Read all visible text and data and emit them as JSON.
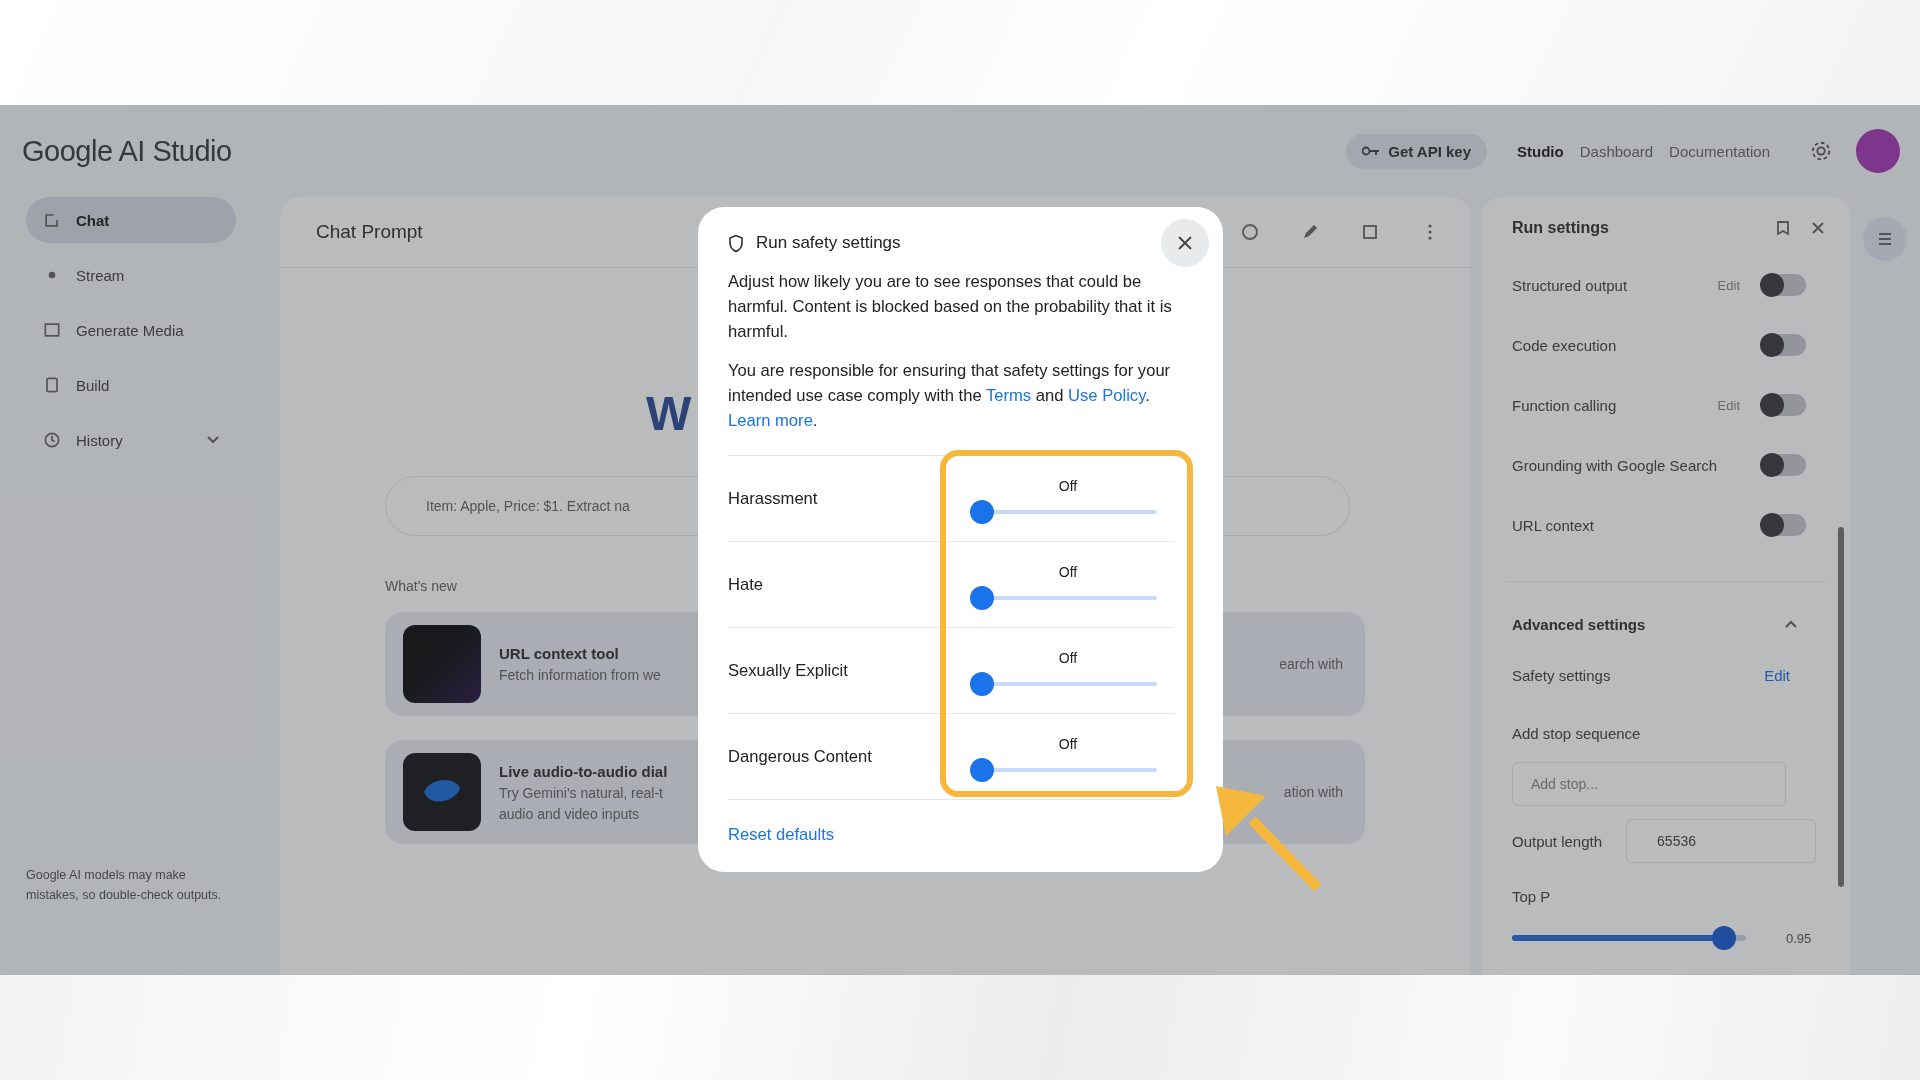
{
  "header": {
    "logo": "Google AI Studio",
    "api_key_button": "Get API key",
    "nav": [
      {
        "label": "Studio",
        "selected": true
      },
      {
        "label": "Dashboard",
        "selected": false
      },
      {
        "label": "Documentation",
        "selected": false
      }
    ]
  },
  "sidebar": {
    "items": [
      {
        "label": "Chat",
        "selected": true
      },
      {
        "label": "Stream",
        "selected": false
      },
      {
        "label": "Generate Media",
        "selected": false
      },
      {
        "label": "Build",
        "selected": false
      },
      {
        "label": "History",
        "selected": false
      }
    ],
    "disclaimer": "Google AI models may make mistakes, so double-check outputs."
  },
  "main": {
    "title": "Chat Prompt",
    "heading": "W",
    "prompt_suggestion": "Item: Apple, Price: $1. Extract na",
    "whats_new": {
      "title": "What's new",
      "cards": [
        {
          "title": "URL context tool",
          "lines": [
            "Fetch information from we"
          ],
          "trailing": "earch with"
        },
        {
          "title": "Live audio-to-audio dial",
          "lines": [
            "Try Gemini's natural, real-t",
            "audio and video inputs"
          ],
          "trailing": "ation with"
        }
      ]
    }
  },
  "run_settings": {
    "title": "Run settings",
    "tools": [
      {
        "label": "Structured output",
        "action": "Edit",
        "on": false
      },
      {
        "label": "Code execution",
        "on": false
      },
      {
        "label": "Function calling",
        "action": "Edit",
        "on": false
      },
      {
        "label": "Grounding with Google Search",
        "on": false
      },
      {
        "label": "URL context",
        "on": false
      }
    ],
    "advanced": {
      "title": "Advanced settings",
      "expanded": true,
      "safety": {
        "label": "Safety settings",
        "action": "Edit"
      },
      "stop_sequence": {
        "label": "Add stop sequence",
        "placeholder": "Add stop..."
      },
      "output_length": {
        "label": "Output length",
        "value": "65536"
      },
      "top_p": {
        "label": "Top P",
        "level": 0.95,
        "reading": "0.95"
      }
    }
  },
  "dialog": {
    "title": "Run safety settings",
    "intro": "Adjust how likely you are to see responses that could be harmful. Content is blocked based on the probability that it is harmful.",
    "notice": [
      {
        "text": "You are responsible for ensuring that safety settings for your intended use case comply with the ",
        "link": false
      },
      {
        "text": "Terms",
        "link": true
      },
      {
        "text": " and ",
        "link": false
      },
      {
        "text": "Use Policy",
        "link": true
      },
      {
        "text": ". ",
        "link": false
      },
      {
        "text": "Learn more",
        "link": true
      },
      {
        "text": ".",
        "link": false
      }
    ],
    "categories": [
      {
        "label": "Harassment",
        "reading": "Off",
        "level": 0
      },
      {
        "label": "Hate",
        "reading": "Off",
        "level": 0
      },
      {
        "label": "Sexually Explicit",
        "reading": "Off",
        "level": 0
      },
      {
        "label": "Dangerous Content",
        "reading": "Off",
        "level": 0
      }
    ],
    "reset": "Reset defaults"
  }
}
